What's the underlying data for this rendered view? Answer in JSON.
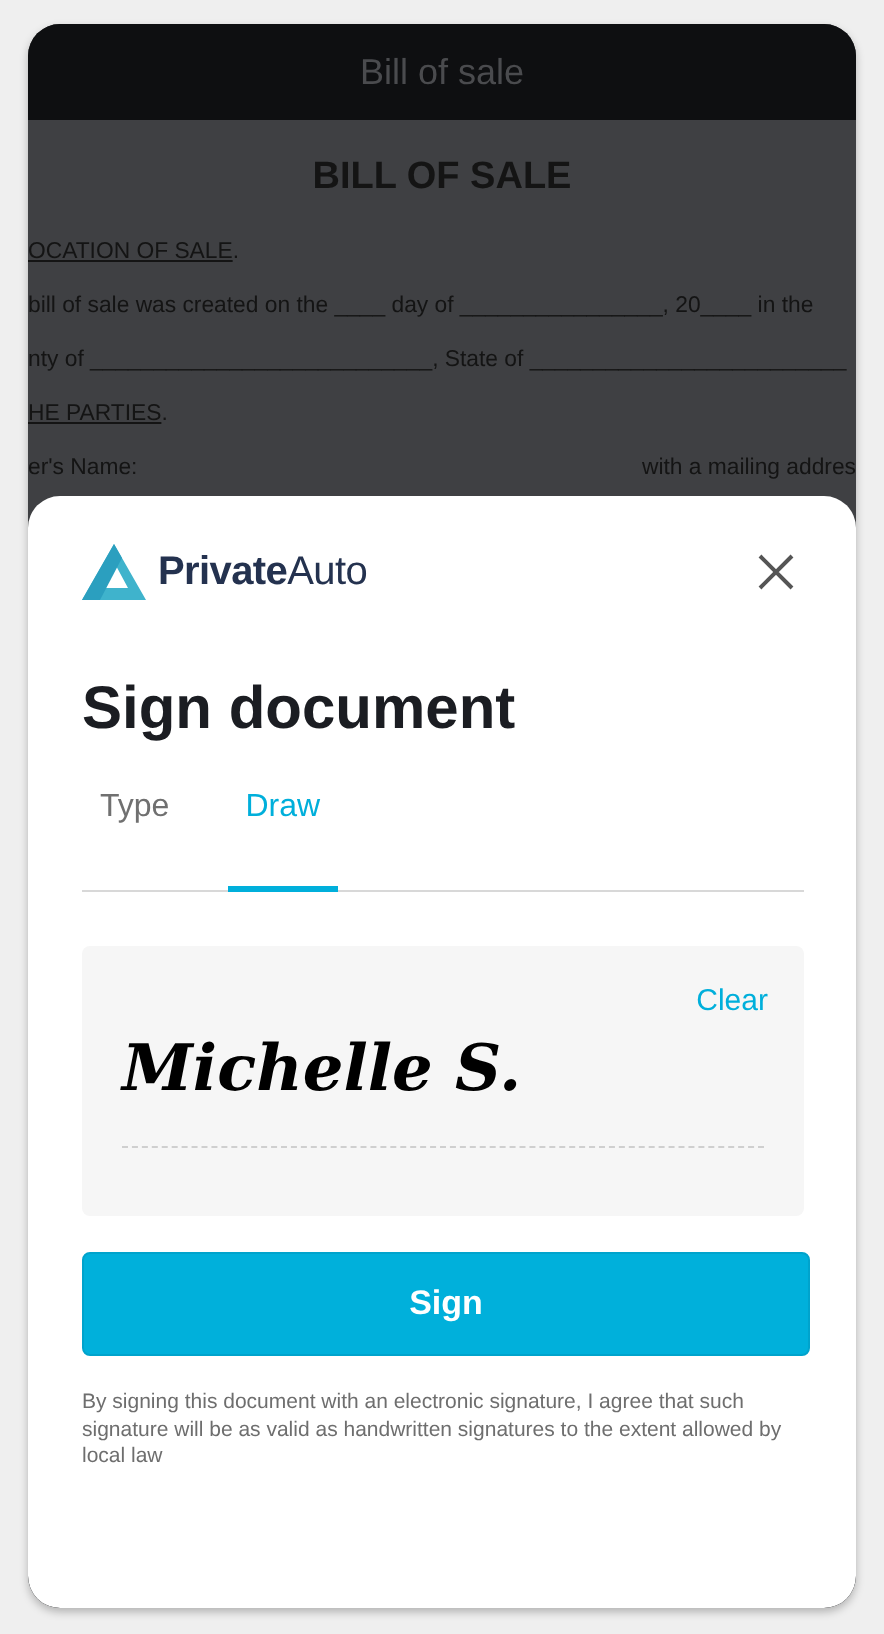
{
  "header": {
    "title": "Bill of sale"
  },
  "document": {
    "heading": "BILL OF SALE",
    "lines": [
      {
        "kind": "section",
        "text": "OCATION OF SALE",
        "after": "."
      },
      {
        "kind": "text",
        "text": "bill of sale was created on the ____ day of ________________, 20____ in the"
      },
      {
        "kind": "text",
        "text": "nty of ___________________________, State of _________________________"
      },
      {
        "kind": "section",
        "text": "HE PARTIES",
        "after": "."
      },
      {
        "kind": "split",
        "left": "er's Name:",
        "right": "with a mailing addres"
      }
    ]
  },
  "dialog": {
    "brand": "**Private**Auto",
    "title": "Sign document",
    "tabs": [
      {
        "label": "Type",
        "selected": false
      },
      {
        "label": "Draw",
        "selected": true
      }
    ],
    "signature": {
      "value": "Michelle S.",
      "clear": "Clear"
    },
    "sign_button": "Sign",
    "disclaimer": "By signing this document with an electronic signature, I agree that such signature will be as valid as handwritten signatures to the extent allowed by local law"
  }
}
